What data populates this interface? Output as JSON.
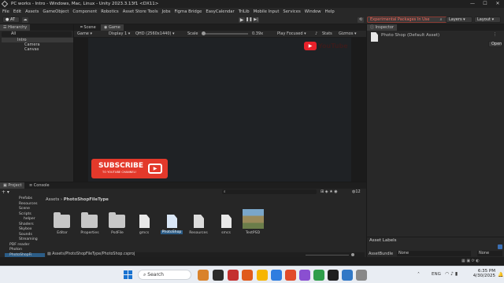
{
  "window": {
    "title": "PC works - Intro - Windows, Mac, Linux - Unity 2023.3.13f1 <DX11>",
    "controls": [
      "—",
      "☐",
      "✕"
    ]
  },
  "menu": [
    "File",
    "Edit",
    "Assets",
    "GameObject",
    "Component",
    "Robotics",
    "Asset Store Tools",
    "Jobs",
    "Figma Bridge",
    "EasyCalendar",
    "TriLib",
    "Mobile Input",
    "Services",
    "Window",
    "Help"
  ],
  "toolbar": {
    "account": "AT",
    "experimental": "Experimental Packages In Use",
    "layers": "Layers",
    "layout": "Layout"
  },
  "hierarchy": {
    "tab": "Hierarchy",
    "search_placeholder": "All",
    "items": [
      {
        "label": "Intro",
        "depth": 0
      },
      {
        "label": "Camera",
        "depth": 1
      },
      {
        "label": "Canvas",
        "depth": 1
      }
    ]
  },
  "scene": {
    "tabs": [
      "Scene",
      "Game"
    ],
    "game_mode": "Game",
    "display": "Display 1",
    "resolution": "QHD (2560x1440)",
    "scale_label": "Scale",
    "scale_value": "0.39x",
    "play_focused": "Play Focused",
    "stats": "Stats",
    "gizmos": "Gizmos",
    "youtube_text": "YouTube",
    "subscribe": "SUBSCRIBE",
    "subscribe_sub": "TO YOUTUBE CHANNEL!"
  },
  "inspector": {
    "tab": "Inspector",
    "asset_title": "Photo Shop (Default Asset)",
    "open_button": "Open",
    "asset_labels": "Asset Labels",
    "assetbundle_label": "AssetBundle",
    "assetbundle_value": "None",
    "assetbundle_variant": "None"
  },
  "project": {
    "tabs": [
      "Project",
      "Console"
    ],
    "breadcrumb": [
      "Assets",
      "PhotoShopFileType"
    ],
    "item_count": "12",
    "tree": [
      "Prefabs",
      "Resources",
      "Scene",
      "Scripts",
      "helper",
      "Shaders",
      "Skybox",
      "Sounds",
      "Streaming",
      "PDF reader",
      "Photon",
      "PhotoShopFi"
    ],
    "assets": [
      {
        "name": "Editor",
        "kind": "folder"
      },
      {
        "name": "Properties",
        "kind": "folder"
      },
      {
        "name": "PsdFile",
        "kind": "folder"
      },
      {
        "name": "gmcs",
        "kind": "file"
      },
      {
        "name": "PhotoShop",
        "kind": "csproj",
        "selected": true
      },
      {
        "name": "Resources",
        "kind": "resx"
      },
      {
        "name": "smcs",
        "kind": "file"
      },
      {
        "name": "TestPSD",
        "kind": "image"
      }
    ],
    "status_path": "Assets/PhotoShopFileType/PhotoShop.csproj"
  },
  "taskbar": {
    "search": "Search",
    "language": "ENG",
    "time": "6:35 PM",
    "date": "4/30/2025",
    "app_colors": [
      "#d9822b",
      "#2b2b2b",
      "#c43030",
      "#e05a1b",
      "#f7b500",
      "#2f7de0",
      "#e14b2b",
      "#8a4fd1",
      "#2e9d4a",
      "#1e1e1e",
      "#3178c6",
      "#888888"
    ]
  }
}
